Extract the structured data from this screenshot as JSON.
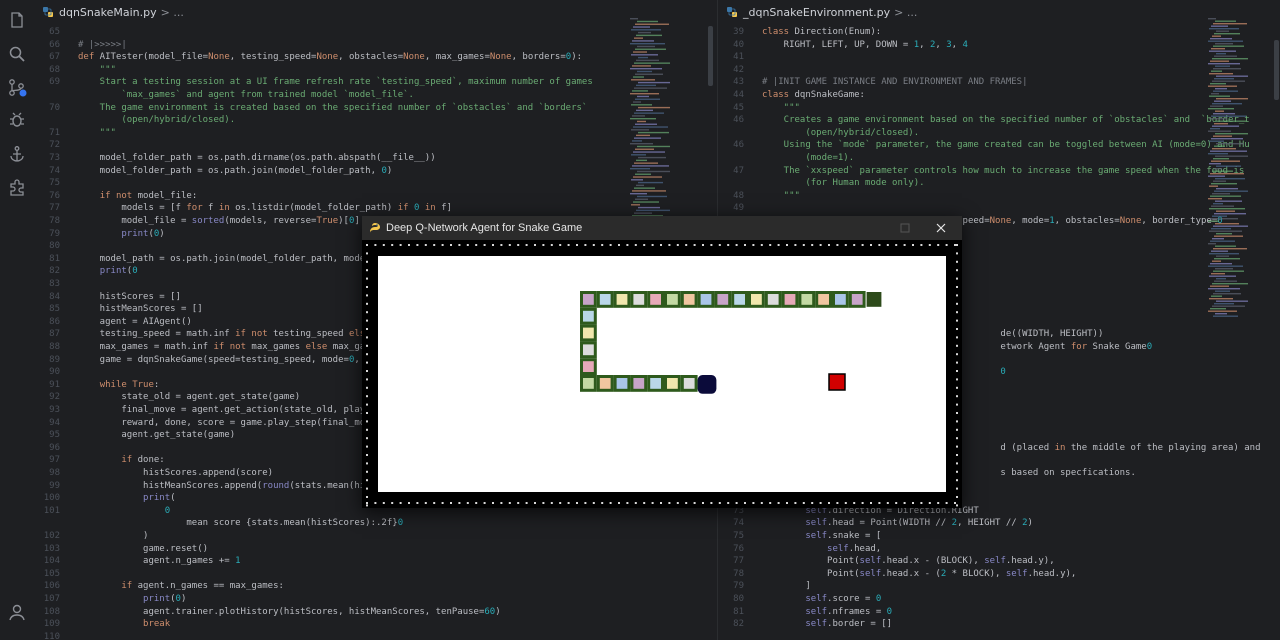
{
  "left_editor": {
    "tab_label": "dqnSnakeMain.py",
    "crumb": "> ...",
    "lines": [
      {
        "n": "65",
        "t": ""
      },
      {
        "n": "66",
        "t": "# |>>>>>|"
      },
      {
        "n": "67",
        "t": "def AITester(model_file=None, testing_speed=None, obstacles=None, max_games=None, borders=\"hybrid\"):"
      },
      {
        "n": "68",
        "t": "    \"\"\""
      },
      {
        "n": "69",
        "t": "    Start a testing session at a UI frame refresh rate `testing_speed`, maximum number of games"
      },
      {
        "n": "",
        "t": "        `max_games` and agent from trained model `model_file`."
      },
      {
        "n": "70",
        "t": "    The game environment is created based on the specified number of `obstacles` and `borders`"
      },
      {
        "n": "",
        "t": "        (open/hybrid/closed)."
      },
      {
        "n": "71",
        "t": "    \"\"\""
      },
      {
        "n": "72",
        "t": ""
      },
      {
        "n": "73",
        "t": "    model_folder_path = os.path.dirname(os.path.abspath(__file__))"
      },
      {
        "n": "74",
        "t": "    model_folder_path = os.path.join(model_folder_path, \"models\")"
      },
      {
        "n": "75",
        "t": ""
      },
      {
        "n": "76",
        "t": "    if not model_file:"
      },
      {
        "n": "77",
        "t": "        models = [f for f in os.listdir(model_folder_path) if \"_aiTestModel\" in f]"
      },
      {
        "n": "78",
        "t": "        model_file = sorted(models, reverse=True)[0]"
      },
      {
        "n": "79",
        "t": "        print(f\"Available Test Models: {models}\")"
      },
      {
        "n": "80",
        "t": ""
      },
      {
        "n": "81",
        "t": "    model_path = os.path.join(model_folder_path, model_file)"
      },
      {
        "n": "82",
        "t": "    print(f\"Playing game in AI mode using best trained model"
      },
      {
        "n": "83",
        "t": ""
      },
      {
        "n": "84",
        "t": "    histScores = []"
      },
      {
        "n": "85",
        "t": "    histMeanScores = []"
      },
      {
        "n": "86",
        "t": "    agent = AIAgent()"
      },
      {
        "n": "87",
        "t": "    testing_speed = math.inf if not testing_speed else testing"
      },
      {
        "n": "88",
        "t": "    max_games = math.inf if not max_games else max_games"
      },
      {
        "n": "89",
        "t": "    game = dqnSnakeGame(speed=testing_speed, mode=0, obstac"
      },
      {
        "n": "90",
        "t": ""
      },
      {
        "n": "91",
        "t": "    while True:"
      },
      {
        "n": "92",
        "t": "        state_old = agent.get_state(game)"
      },
      {
        "n": "93",
        "t": "        final_move = agent.get_action(state_old, playMode"
      },
      {
        "n": "94",
        "t": "        reward, done, score = game.play_step(final_move)"
      },
      {
        "n": "95",
        "t": "        agent.get_state(game)"
      },
      {
        "n": "96",
        "t": ""
      },
      {
        "n": "97",
        "t": "        if done:"
      },
      {
        "n": "98",
        "t": "            histScores.append(score)"
      },
      {
        "n": "99",
        "t": "            histMeanScores.append(round(stats.mean(histSc"
      },
      {
        "n": "100",
        "t": "            print("
      },
      {
        "n": "101",
        "t": "                f\"  game {len(histScores)}\\t score {score"
      },
      {
        "n": "",
        "t": "                    mean score {stats.mean(histScores):.2f}\""
      },
      {
        "n": "102",
        "t": "            )"
      },
      {
        "n": "103",
        "t": "            game.reset()"
      },
      {
        "n": "104",
        "t": "            agent.n_games += 1"
      },
      {
        "n": "105",
        "t": ""
      },
      {
        "n": "106",
        "t": "        if agent.n_games == max_games:"
      },
      {
        "n": "107",
        "t": "            print(\"Maximum number of games reached!\")"
      },
      {
        "n": "108",
        "t": "            agent.trainer.plotHistory(histScores, histMeanScores, tenPause=60)"
      },
      {
        "n": "109",
        "t": "            break"
      },
      {
        "n": "110",
        "t": ""
      }
    ]
  },
  "right_editor": {
    "tab_label": "_dqnSnakeEnvironment.py",
    "crumb": "> ...",
    "lines": [
      {
        "n": "39",
        "t": "class Direction(Enum):"
      },
      {
        "n": "40",
        "t": "    RIGHT, LEFT, UP, DOWN = 1, 2, 3, 4"
      },
      {
        "n": "41",
        "t": ""
      },
      {
        "n": "42",
        "t": ""
      },
      {
        "n": "43",
        "t": "# |INIT GAME INSTANCE AND ENVIRONMENT AND FRAMES|"
      },
      {
        "n": "44",
        "t": "class dqnSnakeGame:"
      },
      {
        "n": "45",
        "t": "    \"\"\""
      },
      {
        "n": "46",
        "t": "    Creates a game environment based on the specified number of `obstacles` and  `border_t"
      },
      {
        "n": "",
        "t": "        (open/hybrid/closed)."
      },
      {
        "n": "46",
        "t": "    Using the `mode` parameter, the game created can be toggled between AI (mode=0) and Hu"
      },
      {
        "n": "",
        "t": "        (mode=1)."
      },
      {
        "n": "47",
        "t": "    The `xxspeed` parameter controls how much to increase the game speed when the food is"
      },
      {
        "n": "",
        "t": "        (for Human mode only)."
      },
      {
        "n": "48",
        "t": "    \"\"\""
      },
      {
        "n": "49",
        "t": ""
      },
      {
        "n": "50",
        "t": "    def __init__(self, speed=SPE, xxspeed=None, mode=1, obstacles=None, border_type=\"hybri"
      },
      {
        "n": "51",
        "t": ""
      },
      {
        "n": "52",
        "t": ""
      },
      {
        "n": "53",
        "t": ""
      },
      {
        "n": "54",
        "t": ""
      },
      {
        "n": "55",
        "t": ""
      },
      {
        "n": "56",
        "t": ""
      },
      {
        "n": "57",
        "t": ""
      },
      {
        "n": "58",
        "t": ""
      },
      {
        "n": "59",
        "t": "                                            de((WIDTH, HEIGHT))"
      },
      {
        "n": "60",
        "t": "                                            etwork Agent for Snake Game\")"
      },
      {
        "n": "61",
        "t": ""
      },
      {
        "n": "62",
        "t": "                                            \", FONT_SIZE, bold=False)"
      },
      {
        "n": "63",
        "t": ""
      },
      {
        "n": "64",
        "t": ""
      },
      {
        "n": "65",
        "t": ""
      },
      {
        "n": "66",
        "t": ""
      },
      {
        "n": "67",
        "t": ""
      },
      {
        "n": "68",
        "t": "                                            d (placed in the middle of the playing area) and"
      },
      {
        "n": "69",
        "t": ""
      },
      {
        "n": "70",
        "t": "                                            s based on specfications."
      },
      {
        "n": "71",
        "t": ""
      },
      {
        "n": "72",
        "t": ""
      },
      {
        "n": "73",
        "t": "        self.direction = Direction.RIGHT"
      },
      {
        "n": "74",
        "t": "        self.head = Point(WIDTH // 2, HEIGHT // 2)"
      },
      {
        "n": "75",
        "t": "        self.snake = ["
      },
      {
        "n": "76",
        "t": "            self.head,"
      },
      {
        "n": "77",
        "t": "            Point(self.head.x - (BLOCK), self.head.y),"
      },
      {
        "n": "78",
        "t": "            Point(self.head.x - (2 * BLOCK), self.head.y),"
      },
      {
        "n": "79",
        "t": "        ]"
      },
      {
        "n": "80",
        "t": "        self.score = 0"
      },
      {
        "n": "81",
        "t": "        self.nframes = 0"
      },
      {
        "n": "82",
        "t": "        self.border = []"
      }
    ]
  },
  "game": {
    "title": "Deep Q-Network Agent for Snake Game",
    "colors": {
      "playfield": "#ffffff",
      "food": "#d10000",
      "head": "#0b0b3a",
      "tail": "#2d4a1a",
      "segment_palette": [
        "#c7a4c8",
        "#b9d7e8",
        "#f1e7ad",
        "#dcdcdc",
        "#e6a9b8",
        "#c3d9a3",
        "#f0c6a0",
        "#a9c5e8"
      ]
    },
    "snake_top_row_count": 17,
    "snake_left_column_count": 5,
    "snake_bottom_row_count": 6
  },
  "activity_bar": {
    "icons": [
      "files-icon",
      "search-icon",
      "source-control-icon",
      "debug-icon",
      "anchor-icon",
      "extensions-icon",
      "account-icon"
    ]
  }
}
